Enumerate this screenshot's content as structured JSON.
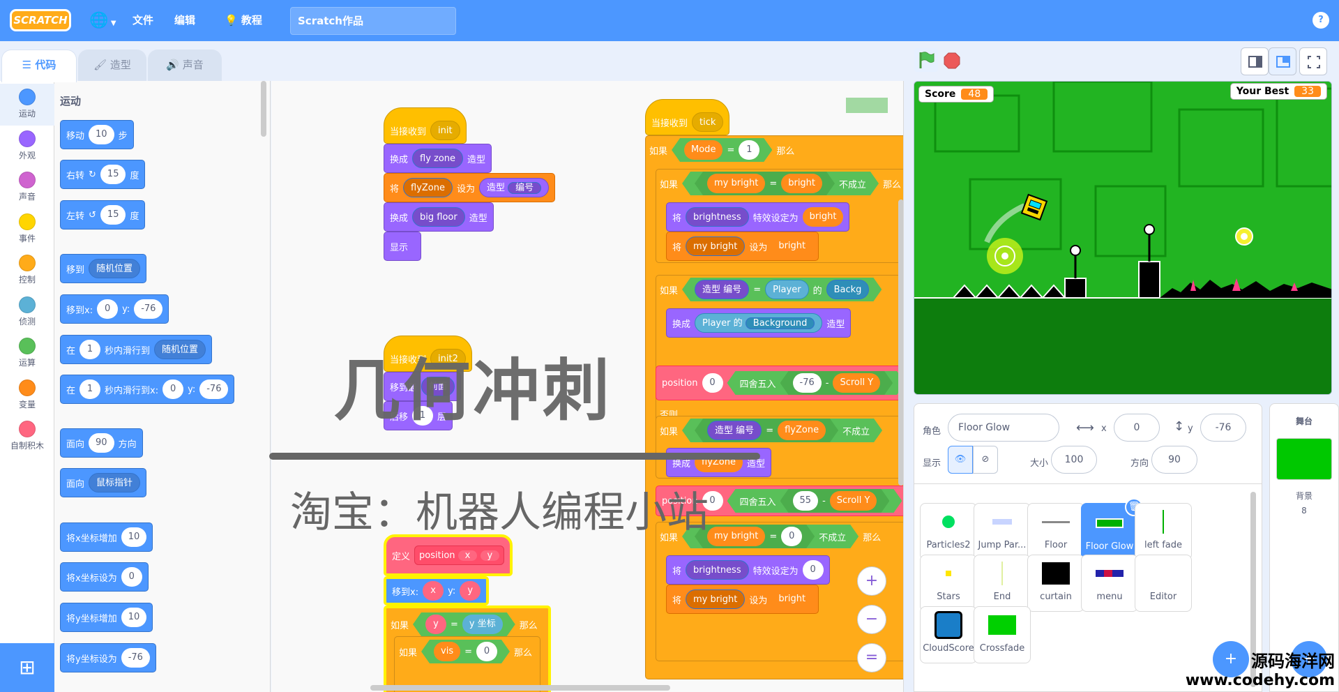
{
  "menubar": {
    "logo": "SCRATCH",
    "file": "文件",
    "edit": "编辑",
    "tutorials": "教程",
    "project_title": "Scratch作品",
    "help": "?"
  },
  "tabs": {
    "code": "代码",
    "costumes": "造型",
    "sounds": "声音"
  },
  "categories": [
    {
      "label": "运动",
      "color": "#4c97ff"
    },
    {
      "label": "外观",
      "color": "#9966ff"
    },
    {
      "label": "声音",
      "color": "#cf63cf"
    },
    {
      "label": "事件",
      "color": "#ffd500"
    },
    {
      "label": "控制",
      "color": "#ffab19"
    },
    {
      "label": "侦测",
      "color": "#5cb1d6"
    },
    {
      "label": "运算",
      "color": "#59c059"
    },
    {
      "label": "变量",
      "color": "#ff8c1a"
    },
    {
      "label": "自制积木",
      "color": "#ff6680"
    }
  ],
  "palette": {
    "title": "运动",
    "move": {
      "a": "移动",
      "v": "10",
      "b": "步"
    },
    "turn_right": {
      "a": "右转",
      "v": "15",
      "b": "度"
    },
    "turn_left": {
      "a": "左转",
      "v": "15",
      "b": "度"
    },
    "goto": {
      "a": "移到",
      "dd": "随机位置"
    },
    "gotoxy": {
      "a": "移到x:",
      "x": "0",
      "y_label": "y:",
      "y": "-76"
    },
    "glide": {
      "a": "在",
      "v": "1",
      "b": "秒内滑行到",
      "dd": "随机位置"
    },
    "glidexy": {
      "a": "在",
      "v": "1",
      "b": "秒内滑行到x:",
      "x": "0",
      "y_label": "y:",
      "y": "-76"
    },
    "point": {
      "a": "面向",
      "v": "90",
      "b": "方向"
    },
    "pointto": {
      "a": "面向",
      "dd": "鼠标指针"
    },
    "changex": {
      "a": "将x坐标增加",
      "v": "10"
    },
    "setx": {
      "a": "将x坐标设为",
      "v": "0"
    },
    "changey": {
      "a": "将y坐标增加",
      "v": "10"
    },
    "sety": {
      "a": "将y坐标设为",
      "v": "-76"
    }
  },
  "script1": {
    "hat": {
      "a": "当接收到",
      "dd": "init"
    },
    "switch1": {
      "a": "换成",
      "dd": "fly zone",
      "b": "造型"
    },
    "set": {
      "a": "将",
      "dd": "flyZone",
      "b": "设为",
      "rep": "造型",
      "rep_dd": "编号"
    },
    "switch2": {
      "a": "换成",
      "dd": "big floor",
      "b": "造型"
    },
    "show": "显示"
  },
  "script2": {
    "hat": "当接收到",
    "hat_dd": "init2",
    "s1": "移到最",
    "s1_dd": "前面",
    "s2": "后移",
    "s2_v": "1",
    "s2_b": "层"
  },
  "script3": {
    "define": {
      "a": "定义",
      "name": "position",
      "p1": "x",
      "p2": "y"
    },
    "gotoxy": {
      "a": "移到x:",
      "x": "x",
      "y_label": "y:",
      "y": "y"
    },
    "if1": {
      "a": "如果",
      "l": "y",
      "eq": "=",
      "r": "y 坐标",
      "b": "那么"
    },
    "if2": {
      "a": "如果",
      "l": "vis",
      "eq": "=",
      "r": "0",
      "b": "那么"
    }
  },
  "script4": {
    "hat": {
      "a": "当接收到",
      "dd": "tick"
    },
    "if_mode": {
      "a": "如果",
      "l": "Mode",
      "eq": "=",
      "r": "1",
      "b": "那么"
    },
    "if_bright": {
      "a": "如果",
      "l": "my bright",
      "eq": "=",
      "r": "bright",
      "not": "不成立",
      "b": "那么"
    },
    "set_effect": {
      "a": "将",
      "dd": "brightness",
      "b": "特效设定为",
      "v": "bright"
    },
    "set_mybright": {
      "a": "将",
      "dd": "my bright",
      "b": "设为",
      "v": "bright"
    },
    "if_costume": {
      "a": "如果",
      "l": "造型",
      "l_dd": "编号",
      "eq": "=",
      "r": "Player",
      "of": "的",
      "r2": "Backg"
    },
    "switch": {
      "a": "换成",
      "r": "Player",
      "of": "的",
      "r2": "Background",
      "b": "造型"
    },
    "position1": {
      "a": "position",
      "v": "0",
      "round": "四舍五入",
      "n": "-76",
      "minus": "-",
      "s": "Scroll Y"
    },
    "else": "否则",
    "if_fly": {
      "a": "如果",
      "l": "造型",
      "l_dd": "编号",
      "eq": "=",
      "r": "flyZone",
      "not": "不成立"
    },
    "switch_fly": {
      "a": "换成",
      "v": "flyZone",
      "b": "造型"
    },
    "position2": {
      "a": "position",
      "v": "0",
      "round": "四舍五入",
      "n": "55",
      "minus": "-",
      "s": "Scroll Y"
    },
    "if_zero": {
      "a": "如果",
      "l": "my bright",
      "eq": "=",
      "r": "0",
      "not": "不成立",
      "b": "那么"
    },
    "set_effect2": {
      "a": "将",
      "dd": "brightness",
      "b": "特效设定为",
      "v": "0"
    },
    "set_mybright2": {
      "a": "将",
      "dd": "my bright",
      "b": "设为",
      "v": "bright"
    }
  },
  "watermark": {
    "title": "几何冲刺",
    "shop": "淘宝：机器人编程小站",
    "site_cn": "源码海洋网",
    "site_url": "www.codehy.com"
  },
  "zoom": {
    "in": "+",
    "out": "−",
    "reset": "="
  },
  "stage": {
    "score_label": "Score",
    "score": "48",
    "best_label": "Your Best",
    "best": "33"
  },
  "sprite": {
    "label": "角色",
    "name": "Floor Glow",
    "x_label": "x",
    "x": "0",
    "y_label": "y",
    "y": "-76",
    "show_label": "显示",
    "size_label": "大小",
    "size": "100",
    "dir_label": "方向",
    "dir": "90"
  },
  "sprites": [
    {
      "name": "Particles2"
    },
    {
      "name": "Jump Par..."
    },
    {
      "name": "Floor"
    },
    {
      "name": "Floor Glow",
      "selected": true
    },
    {
      "name": "left fade"
    },
    {
      "name": "Stars"
    },
    {
      "name": "End"
    },
    {
      "name": "curtain"
    },
    {
      "name": "menu"
    },
    {
      "name": "Editor"
    },
    {
      "name": "CloudScore"
    },
    {
      "name": "Crossfade"
    }
  ],
  "stage_pane": {
    "title": "舞台",
    "backdrop_label": "背景",
    "backdrop_count": "8"
  }
}
